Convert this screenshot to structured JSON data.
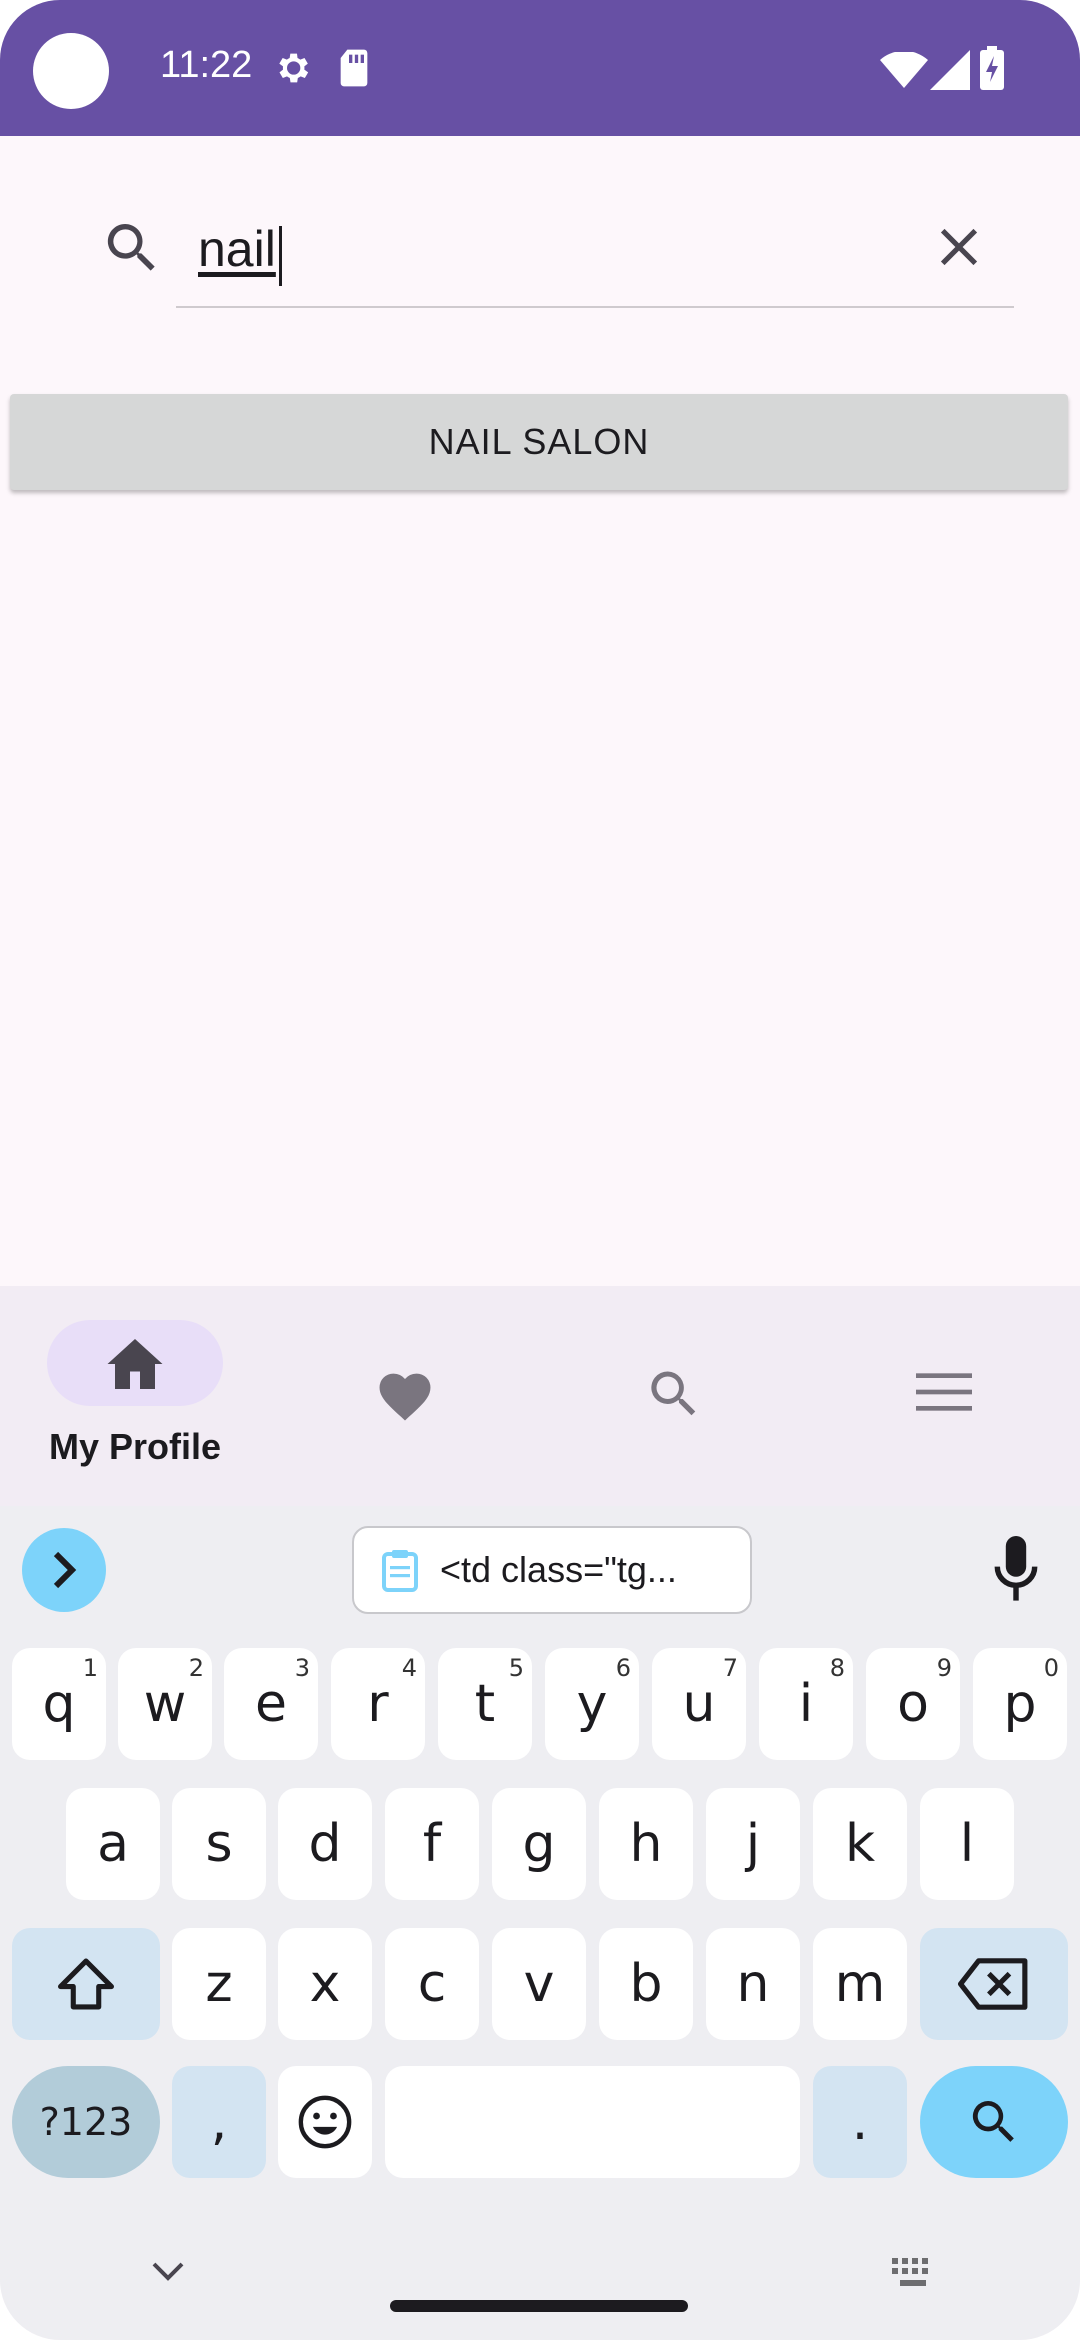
{
  "status_bar": {
    "time": "11:22"
  },
  "search": {
    "query": "nail"
  },
  "suggestions": [
    {
      "label": "NAIL SALON"
    }
  ],
  "bottom_nav": {
    "active_label": "My Profile",
    "items": [
      "home-icon",
      "heart-icon",
      "search-icon",
      "menu-icon"
    ]
  },
  "keyboard": {
    "clipboard_text": "<td class=\"tg...",
    "row1": [
      {
        "k": "q",
        "s": "1"
      },
      {
        "k": "w",
        "s": "2"
      },
      {
        "k": "e",
        "s": "3"
      },
      {
        "k": "r",
        "s": "4"
      },
      {
        "k": "t",
        "s": "5"
      },
      {
        "k": "y",
        "s": "6"
      },
      {
        "k": "u",
        "s": "7"
      },
      {
        "k": "i",
        "s": "8"
      },
      {
        "k": "o",
        "s": "9"
      },
      {
        "k": "p",
        "s": "0"
      }
    ],
    "row2": [
      "a",
      "s",
      "d",
      "f",
      "g",
      "h",
      "j",
      "k",
      "l"
    ],
    "row3": [
      "z",
      "x",
      "c",
      "v",
      "b",
      "n",
      "m"
    ],
    "symbols_label": "?123",
    "comma": ",",
    "period": "."
  },
  "colors": {
    "status_bar": "#6750a4",
    "accent_blue": "#7dd3fa",
    "nav_background": "#f2ecf4",
    "active_pill": "#e8def8"
  }
}
